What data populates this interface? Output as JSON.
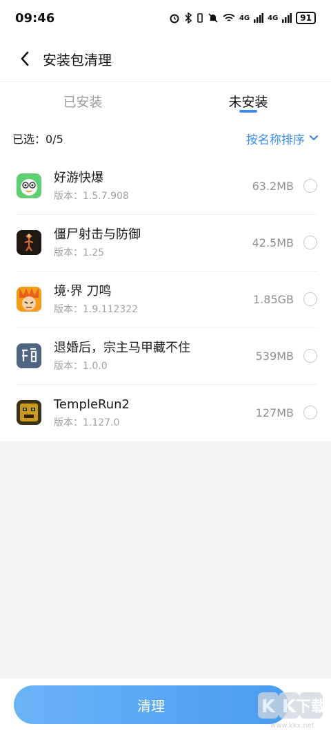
{
  "status": {
    "time": "09:46",
    "battery": "91",
    "net1": "4G",
    "net2": "4G"
  },
  "header": {
    "title": "安装包清理"
  },
  "tabs": [
    {
      "label": "已安装",
      "active": false
    },
    {
      "label": "未安装",
      "active": true
    }
  ],
  "filter": {
    "selected": "已选：0/5",
    "sort": "按名称排序"
  },
  "apps": [
    {
      "name": "好游快爆",
      "version": "版本：1.5.7.908",
      "size": "63.2MB",
      "icon": "haoyou-icon"
    },
    {
      "name": "僵尸射击与防御",
      "version": "版本：1.25",
      "size": "42.5MB",
      "icon": "zombie-icon"
    },
    {
      "name": "境·界 刀鸣",
      "version": "版本：1.9.112322",
      "size": "1.85GB",
      "icon": "bleach-icon"
    },
    {
      "name": "退婚后，宗主马甲藏不住",
      "version": "版本：1.0.0",
      "size": "539MB",
      "icon": "hun-icon"
    },
    {
      "name": "TempleRun2",
      "version": "版本：1.127.0",
      "size": "127MB",
      "icon": "templerun-icon"
    }
  ],
  "bottom": {
    "clean_label": "清理"
  },
  "watermark": {
    "text": "KK下载",
    "url_text": "www.kkx.net"
  },
  "colors": {
    "accent": "#3b8cf0",
    "background": "#f3f4f6"
  }
}
